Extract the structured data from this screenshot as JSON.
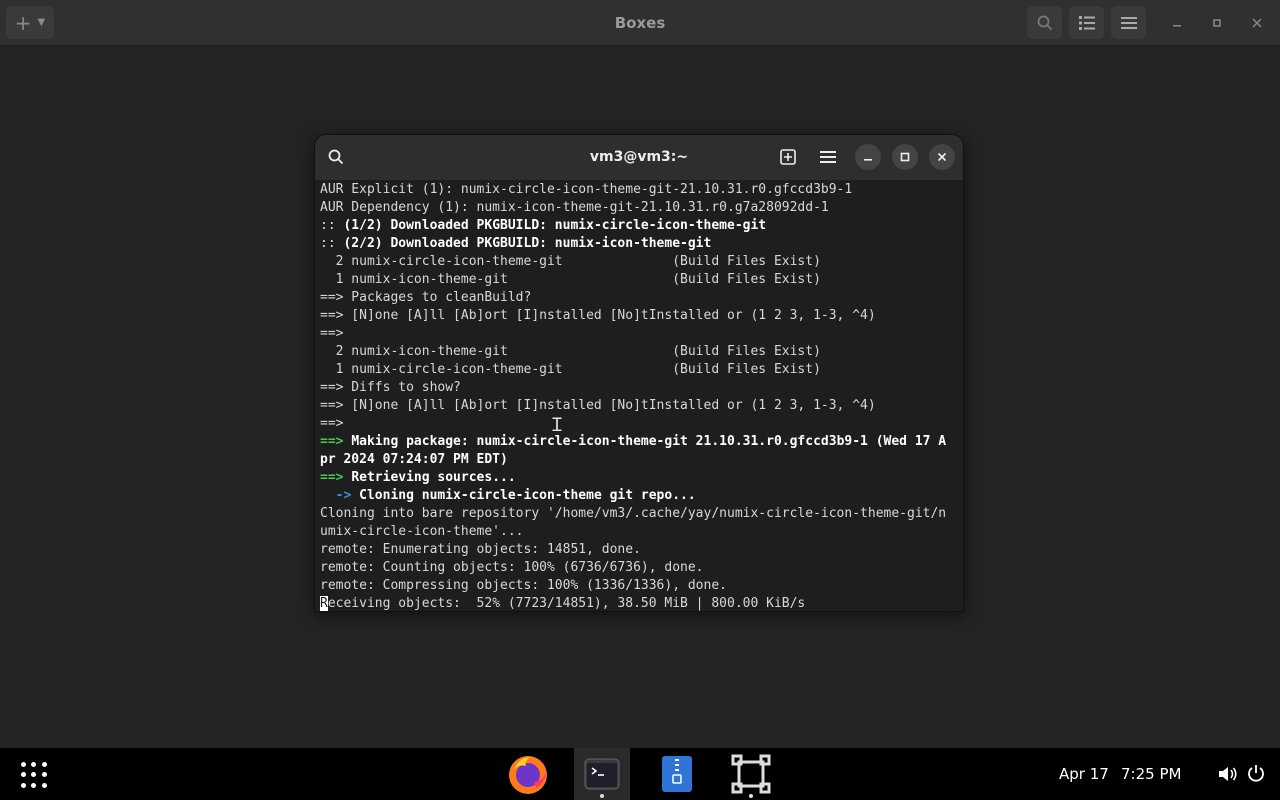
{
  "boxes": {
    "title": "Boxes"
  },
  "terminal": {
    "title": "vm3@vm3:~",
    "lines": [
      [
        {
          "t": "AUR Explicit (1): numix-circle-icon-theme-git-21.10.31.r0.gfccd3b9-1",
          "s": ""
        }
      ],
      [
        {
          "t": "AUR Dependency (1): numix-icon-theme-git-21.10.31.r0.g7a28092dd-1",
          "s": ""
        }
      ],
      [
        {
          "t": ":: ",
          "s": ""
        },
        {
          "t": "(1/2) Downloaded PKGBUILD: numix-circle-icon-theme-git",
          "s": "b"
        }
      ],
      [
        {
          "t": ":: ",
          "s": ""
        },
        {
          "t": "(2/2) Downloaded PKGBUILD: numix-icon-theme-git",
          "s": "b"
        }
      ],
      [
        {
          "t": "  2 numix-circle-icon-theme-git              (Build Files Exist)",
          "s": ""
        }
      ],
      [
        {
          "t": "  1 numix-icon-theme-git                     (Build Files Exist)",
          "s": ""
        }
      ],
      [
        {
          "t": "==> Packages to cleanBuild?",
          "s": ""
        }
      ],
      [
        {
          "t": "==> [N]one [A]ll [Ab]ort [I]nstalled [No]tInstalled or (1 2 3, 1-3, ^4)",
          "s": ""
        }
      ],
      [
        {
          "t": "==> ",
          "s": ""
        }
      ],
      [
        {
          "t": "  2 numix-icon-theme-git                     (Build Files Exist)",
          "s": ""
        }
      ],
      [
        {
          "t": "  1 numix-circle-icon-theme-git              (Build Files Exist)",
          "s": ""
        }
      ],
      [
        {
          "t": "==> Diffs to show?",
          "s": ""
        }
      ],
      [
        {
          "t": "==> [N]one [A]ll [Ab]ort [I]nstalled [No]tInstalled or (1 2 3, 1-3, ^4)",
          "s": ""
        }
      ],
      [
        {
          "t": "==> ",
          "s": ""
        }
      ],
      [
        {
          "t": "==> ",
          "s": "g"
        },
        {
          "t": "Making package: numix-circle-icon-theme-git 21.10.31.r0.gfccd3b9-1 (Wed 17 A",
          "s": "b"
        }
      ],
      [
        {
          "t": "pr 2024 07:24:07 PM EDT)",
          "s": "b"
        }
      ],
      [
        {
          "t": "==> ",
          "s": "g"
        },
        {
          "t": "Retrieving sources...",
          "s": "b"
        }
      ],
      [
        {
          "t": "  -> ",
          "s": "bl"
        },
        {
          "t": "Cloning numix-circle-icon-theme git repo...",
          "s": "b"
        }
      ],
      [
        {
          "t": "Cloning into bare repository '/home/vm3/.cache/yay/numix-circle-icon-theme-git/n",
          "s": ""
        }
      ],
      [
        {
          "t": "umix-circle-icon-theme'...",
          "s": ""
        }
      ],
      [
        {
          "t": "remote: Enumerating objects: 14851, done.",
          "s": ""
        }
      ],
      [
        {
          "t": "remote: Counting objects: 100% (6736/6736), done.",
          "s": ""
        }
      ],
      [
        {
          "t": "remote: Compressing objects: 100% (1336/1336), done.",
          "s": ""
        }
      ],
      [
        {
          "t": "R",
          "s": "cursor"
        },
        {
          "t": "eceiving objects:  52% (7723/14851), 38.50 MiB | 800.00 KiB/s",
          "s": ""
        }
      ]
    ]
  },
  "panel": {
    "date": "Apr 17",
    "time": "7:25 PM"
  },
  "icons": [
    "apps-grid-icon",
    "firefox-icon",
    "terminal-icon",
    "file-manager-icon",
    "boxes-icon",
    "volume-icon",
    "power-icon",
    "search-icon",
    "add-icon",
    "menu-icon"
  ]
}
